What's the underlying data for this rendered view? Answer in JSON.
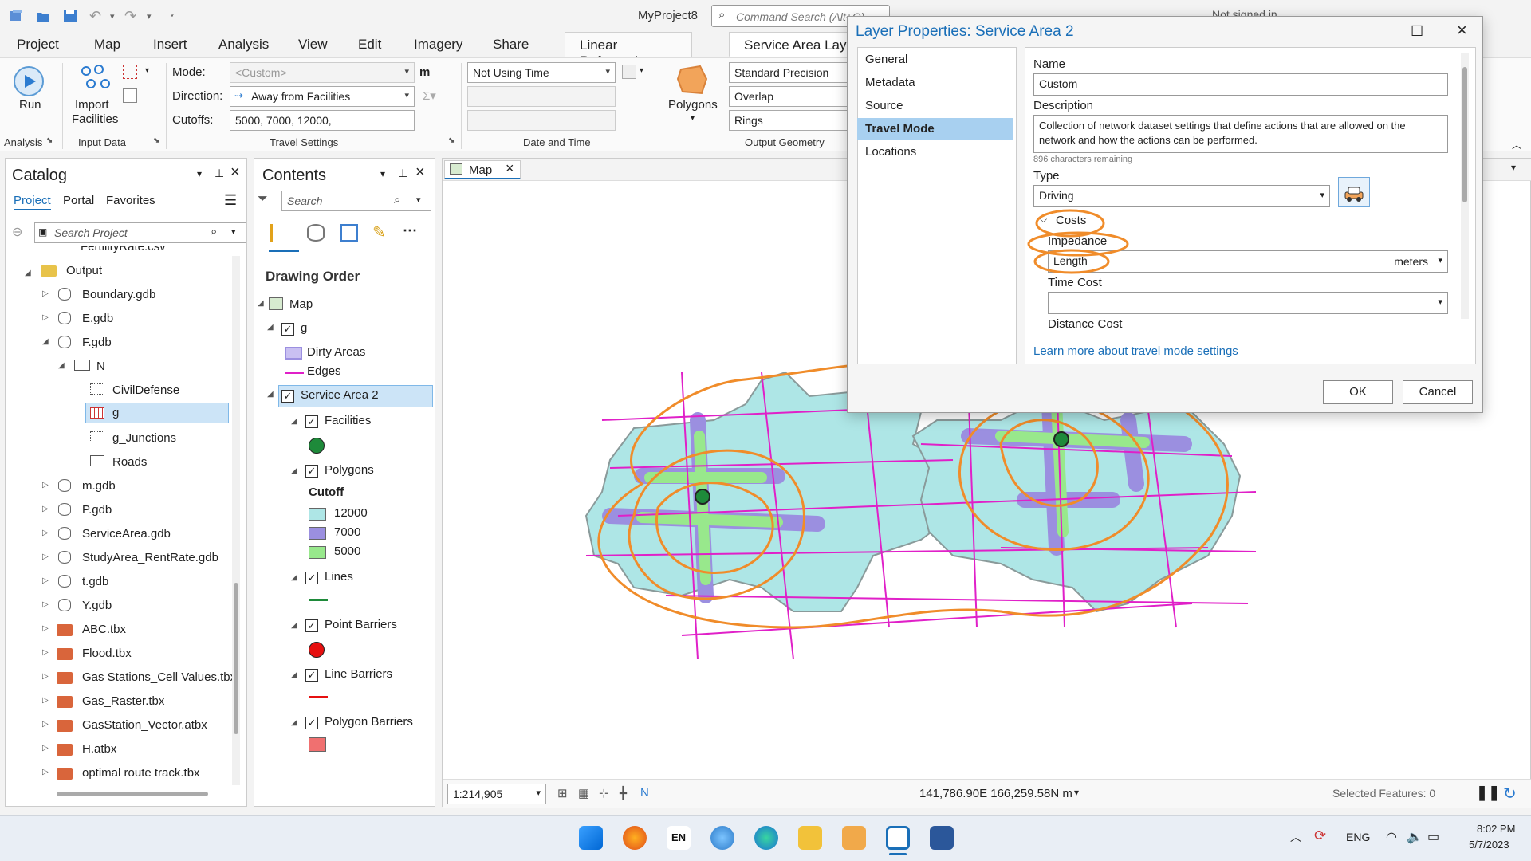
{
  "window": {
    "project_name": "MyProject8",
    "command_search_placeholder": "Command Search (Alt+Q)",
    "signin": "Not signed in"
  },
  "ribbon_tabs": [
    "Project",
    "Map",
    "Insert",
    "Analysis",
    "View",
    "Edit",
    "Imagery",
    "Share"
  ],
  "context_tabs": {
    "linear_ref": "Linear Referencing",
    "service_area": "Service Area Layer"
  },
  "ribbon": {
    "run_label": "Run",
    "import_label_1": "Import",
    "import_label_2": "Facilities",
    "mode_label": "Mode:",
    "mode_value": "<Custom>",
    "mode_unit": "m",
    "direction_label": "Direction:",
    "direction_value": "Away from Facilities",
    "cutoffs_label": "Cutoffs:",
    "cutoffs_value": "5000, 7000, 12000,",
    "time_value": "Not Using Time",
    "polygons_label": "Polygons",
    "precision_value": "Standard Precision",
    "overlap_value": "Overlap",
    "rings_value": "Rings",
    "groups": {
      "analysis": "Analysis",
      "input_data": "Input Data",
      "travel_settings": "Travel Settings",
      "date_time": "Date and Time",
      "output_geometry": "Output Geometry"
    }
  },
  "catalog": {
    "title": "Catalog",
    "tabs": [
      "Project",
      "Portal",
      "Favorites"
    ],
    "search_placeholder": "Search Project",
    "partial_item": "FertilityRate.csv",
    "items": {
      "output": "Output",
      "boundary": "Boundary.gdb",
      "e": "E.gdb",
      "f": "F.gdb",
      "n": "N",
      "civil": "CivilDefense",
      "g": "g",
      "gj": "g_Junctions",
      "roads": "Roads",
      "m": "m.gdb",
      "p": "P.gdb",
      "sa": "ServiceArea.gdb",
      "study": "StudyArea_RentRate.gdb",
      "t": "t.gdb",
      "y": "Y.gdb",
      "abc": "ABC.tbx",
      "flood": "Flood.tbx",
      "gas_cell": "Gas Stations_Cell Values.tbx",
      "gas_raster": "Gas_Raster.tbx",
      "gas_vector": "GasStation_Vector.atbx",
      "h": "H.atbx",
      "optimal": "optimal route track.tbx"
    }
  },
  "contents": {
    "title": "Contents",
    "search_placeholder": "Search",
    "drawing_order": "Drawing Order",
    "map": "Map",
    "g": "g",
    "dirty": "Dirty Areas",
    "edges": "Edges",
    "service_area": "Service Area 2",
    "facilities": "Facilities",
    "polygons": "Polygons",
    "cutoff": "Cutoff",
    "c12000": "12000",
    "c7000": "7000",
    "c5000": "5000",
    "lines": "Lines",
    "point_barriers": "Point Barriers",
    "line_barriers": "Line Barriers",
    "polygon_barriers": "Polygon Barriers"
  },
  "map_view": {
    "tab": "Map",
    "scale": "1:214,905",
    "coords": "141,786.90E 166,259.58N m",
    "selected": "Selected Features: 0"
  },
  "dialog": {
    "title": "Layer Properties: Service Area 2",
    "nav": [
      "General",
      "Metadata",
      "Source",
      "Travel Mode",
      "Locations"
    ],
    "name_label": "Name",
    "name_value": "Custom",
    "description_label": "Description",
    "description_value": "Collection of network dataset settings that define actions that are allowed on the network and how the actions can be performed.",
    "chars_remaining": "896 characters remaining",
    "type_label": "Type",
    "type_value": "Driving",
    "costs_label": "Costs",
    "impedance_label": "Impedance",
    "impedance_value": "Length",
    "impedance_unit": "meters",
    "time_cost_label": "Time Cost",
    "distance_cost_label": "Distance Cost",
    "learn_more": "Learn more about travel mode settings",
    "ok": "OK",
    "cancel": "Cancel"
  },
  "taskbar": {
    "lang": "ENG",
    "time": "8:02 PM",
    "date": "5/7/2023",
    "input_lang": "EN"
  },
  "colors": {
    "accent": "#1a6fb8",
    "selected_bg": "#cce4f7",
    "ring_12000": "#aee6e6",
    "ring_7000": "#9b8fe0",
    "ring_5000": "#98e88c",
    "edges": "#e020c8",
    "annotation": "#f08c2a",
    "facility": "#1e8a3a"
  }
}
